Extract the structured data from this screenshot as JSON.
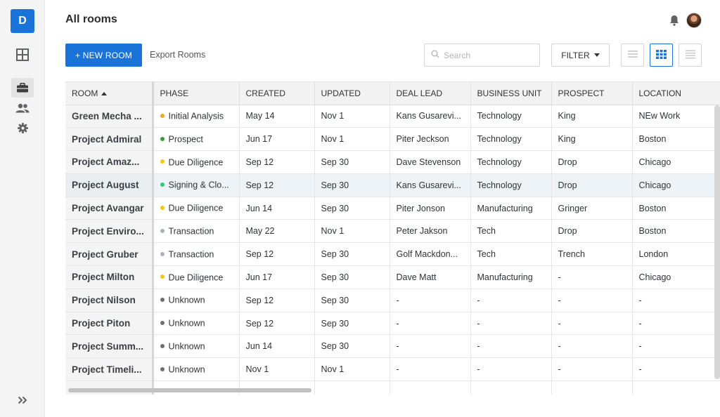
{
  "app": {
    "logo_letter": "D"
  },
  "sidebar": {
    "items": [
      {
        "name": "dashboard",
        "icon": "grid-icon"
      },
      {
        "name": "rooms",
        "icon": "briefcase-icon",
        "active": true
      },
      {
        "name": "users",
        "icon": "users-icon"
      },
      {
        "name": "settings",
        "icon": "gear-icon"
      }
    ],
    "expand_icon": "double-chevron-right-icon"
  },
  "header": {
    "title": "All rooms"
  },
  "toolbar": {
    "new_room_label": "+ NEW ROOM",
    "export_label": "Export Rooms",
    "search_placeholder": "Search",
    "search_value": "",
    "filter_label": "FILTER",
    "views": [
      "list-view-icon",
      "grid-view-icon",
      "compact-view-icon"
    ],
    "active_view": "grid-view-icon"
  },
  "colors": {
    "accent": "#1a73d9",
    "phase_initial_analysis": "#f5a623",
    "phase_prospect": "#3d9a3d",
    "phase_due_diligence": "#f2c811",
    "phase_signing": "#2ecc71",
    "phase_transaction": "#a8b3bd",
    "phase_unknown": "#6f6f6f"
  },
  "table": {
    "columns": [
      "ROOM",
      "PHASE",
      "CREATED",
      "UPDATED",
      "DEAL LEAD",
      "BUSINESS UNIT",
      "PROSPECT",
      "LOCATION"
    ],
    "sorted_column": "ROOM",
    "sort_direction": "ascending",
    "rows": [
      {
        "room": "Green Mecha ...",
        "phase": "Initial Analysis",
        "dot": "#f5a623",
        "created": "May 14",
        "updated": "Nov 1",
        "deal_lead": "Kans Gusarevi...",
        "business_unit": "Technology",
        "prospect": "King",
        "location": "NEw Work"
      },
      {
        "room": "Project Admiral",
        "phase": "Prospect",
        "dot": "#3d9a3d",
        "created": "Jun 17",
        "updated": "Nov 1",
        "deal_lead": "Piter Jeckson",
        "business_unit": "Technology",
        "prospect": "King",
        "location": "Boston"
      },
      {
        "room": "Project Amaz...",
        "phase": "Due Diligence",
        "dot": "#f2c811",
        "created": "Sep 12",
        "updated": "Sep 30",
        "deal_lead": "Dave Stevenson",
        "business_unit": "Technology",
        "prospect": "Drop",
        "location": "Chicago"
      },
      {
        "room": "Project August",
        "phase": "Signing & Clo...",
        "dot": "#2ecc71",
        "created": "Sep 12",
        "updated": "Sep 30",
        "deal_lead": "Kans Gusarevi...",
        "business_unit": "Technology",
        "prospect": "Drop",
        "location": "Chicago",
        "highlight": true
      },
      {
        "room": "Project Avangar",
        "phase": "Due Diligence",
        "dot": "#f2c811",
        "created": "Jun 14",
        "updated": "Sep 30",
        "deal_lead": "Piter Jonson",
        "business_unit": "Manufacturing",
        "prospect": "Gringer",
        "location": "Boston"
      },
      {
        "room": "Project Enviro...",
        "phase": "Transaction",
        "dot": "#a8b3bd",
        "created": "May 22",
        "updated": "Nov 1",
        "deal_lead": "Peter Jakson",
        "business_unit": "Tech",
        "prospect": "Drop",
        "location": "Boston"
      },
      {
        "room": "Project Gruber",
        "phase": "Transaction",
        "dot": "#a8b3bd",
        "created": "Sep 12",
        "updated": "Sep 30",
        "deal_lead": "Golf Mackdon...",
        "business_unit": "Tech",
        "prospect": "Trench",
        "location": "London"
      },
      {
        "room": "Project Milton",
        "phase": "Due Diligence",
        "dot": "#f2c811",
        "created": "Jun 17",
        "updated": "Sep 30",
        "deal_lead": "Dave Matt",
        "business_unit": "Manufacturing",
        "prospect": "-",
        "location": "Chicago"
      },
      {
        "room": "Project Nilson",
        "phase": "Unknown",
        "dot": "#6f6f6f",
        "created": "Sep 12",
        "updated": "Sep 30",
        "deal_lead": "-",
        "business_unit": "-",
        "prospect": "-",
        "location": "-"
      },
      {
        "room": "Project Piton",
        "phase": "Unknown",
        "dot": "#6f6f6f",
        "created": "Sep 12",
        "updated": "Sep 30",
        "deal_lead": "-",
        "business_unit": "-",
        "prospect": "-",
        "location": "-"
      },
      {
        "room": "Project Summ...",
        "phase": "Unknown",
        "dot": "#6f6f6f",
        "created": "Jun 14",
        "updated": "Sep 30",
        "deal_lead": "-",
        "business_unit": "-",
        "prospect": "-",
        "location": "-"
      },
      {
        "room": "Project Timeli...",
        "phase": "Unknown",
        "dot": "#6f6f6f",
        "created": "Nov 1",
        "updated": "Nov 1",
        "deal_lead": "-",
        "business_unit": "-",
        "prospect": "-",
        "location": "-"
      },
      {
        "room": "",
        "phase": "",
        "dot": "",
        "created": "",
        "updated": "",
        "deal_lead": "",
        "business_unit": "",
        "prospect": "",
        "location": ""
      }
    ]
  }
}
